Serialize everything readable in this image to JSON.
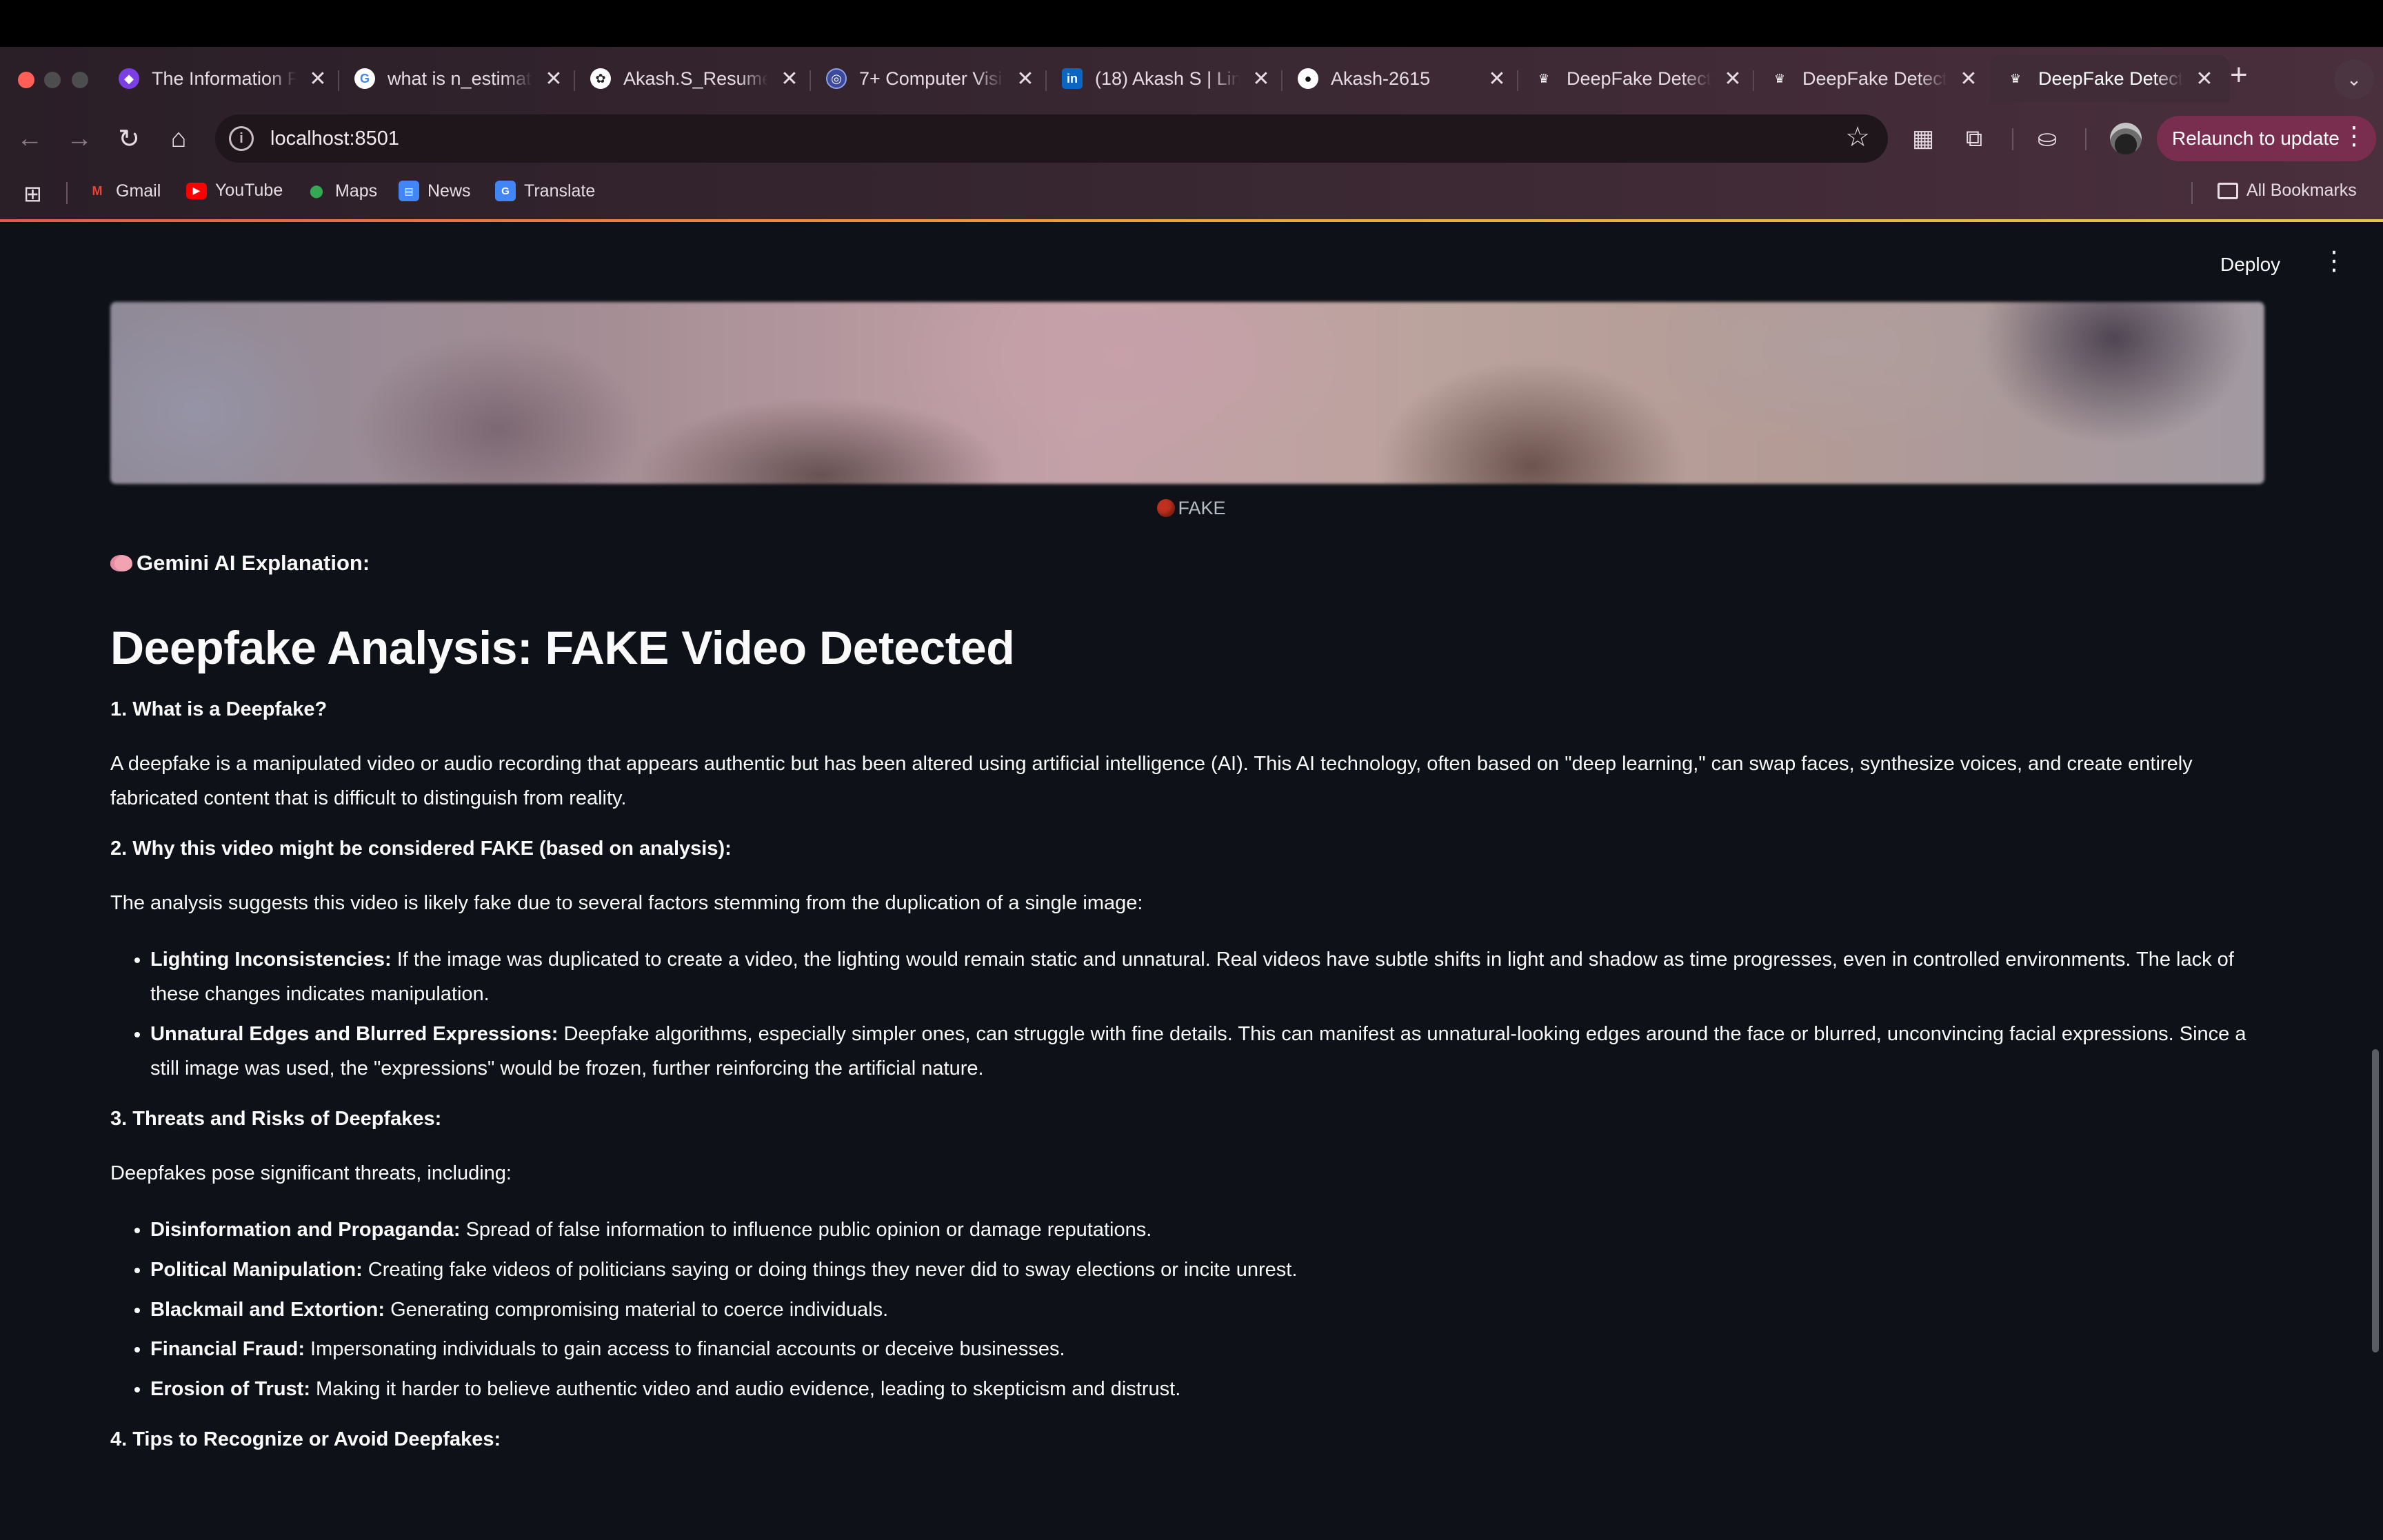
{
  "browser": {
    "tabs": [
      {
        "label": "The Information R",
        "favicon": "notion-ai-icon",
        "color": "#7b3fe4"
      },
      {
        "label": "what is n_estimat",
        "favicon": "google-icon",
        "color": "#ffffff"
      },
      {
        "label": "Akash.S_Resume",
        "favicon": "chatgpt-icon",
        "color": "#ffffff"
      },
      {
        "label": "7+ Computer Visi",
        "favicon": "site-icon",
        "color": "#3b4a9c"
      },
      {
        "label": "(18) Akash S | Lin",
        "favicon": "linkedin-icon",
        "color": "#0a66c2"
      },
      {
        "label": "Akash-2615",
        "favicon": "github-icon",
        "color": "#ffffff"
      },
      {
        "label": "DeepFake Detect",
        "favicon": "streamlit-icon",
        "color": "#ffffff"
      },
      {
        "label": "DeepFake Detect",
        "favicon": "streamlit-icon",
        "color": "#ffffff"
      },
      {
        "label": "DeepFake Detect",
        "favicon": "streamlit-icon",
        "color": "#ffffff"
      }
    ],
    "new_tab": "+",
    "url": "localhost:8501",
    "relaunch_label": "Relaunch to update",
    "bookmarks": [
      {
        "label": "Gmail",
        "icon": "gmail-icon"
      },
      {
        "label": "YouTube",
        "icon": "youtube-icon"
      },
      {
        "label": "Maps",
        "icon": "maps-icon"
      },
      {
        "label": "News",
        "icon": "news-icon"
      },
      {
        "label": "Translate",
        "icon": "translate-icon"
      }
    ],
    "all_bookmarks": "All Bookmarks"
  },
  "app": {
    "deploy_label": "Deploy",
    "verdict": "FAKE",
    "explanation_label": "Gemini AI Explanation:",
    "title": "Deepfake Analysis: FAKE Video Detected",
    "s1_heading": "1. What is a Deepfake?",
    "s1_text": "A deepfake is a manipulated video or audio recording that appears authentic but has been altered using artificial intelligence (AI). This AI technology, often based on \"deep learning,\" can swap faces, synthesize voices, and create entirely fabricated content that is difficult to distinguish from reality.",
    "s2_heading": "2. Why this video might be considered FAKE (based on analysis):",
    "s2_text": "The analysis suggests this video is likely fake due to several factors stemming from the duplication of a single image:",
    "s2_items": [
      {
        "bold": "Lighting Inconsistencies:",
        "text": " If the image was duplicated to create a video, the lighting would remain static and unnatural. Real videos have subtle shifts in light and shadow as time progresses, even in controlled environments. The lack of these changes indicates manipulation."
      },
      {
        "bold": "Unnatural Edges and Blurred Expressions:",
        "text": " Deepfake algorithms, especially simpler ones, can struggle with fine details. This can manifest as unnatural-looking edges around the face or blurred, unconvincing facial expressions. Since a still image was used, the \"expressions\" would be frozen, further reinforcing the artificial nature."
      }
    ],
    "s3_heading": "3. Threats and Risks of Deepfakes:",
    "s3_text": "Deepfakes pose significant threats, including:",
    "s3_items": [
      {
        "bold": "Disinformation and Propaganda:",
        "text": " Spread of false information to influence public opinion or damage reputations."
      },
      {
        "bold": "Political Manipulation:",
        "text": " Creating fake videos of politicians saying or doing things they never did to sway elections or incite unrest."
      },
      {
        "bold": "Blackmail and Extortion:",
        "text": " Generating compromising material to coerce individuals."
      },
      {
        "bold": "Financial Fraud:",
        "text": " Impersonating individuals to gain access to financial accounts or deceive businesses."
      },
      {
        "bold": "Erosion of Trust:",
        "text": " Making it harder to believe authentic video and audio evidence, leading to skepticism and distrust."
      }
    ],
    "s4_heading": "4. Tips to Recognize or Avoid Deepfakes:"
  }
}
